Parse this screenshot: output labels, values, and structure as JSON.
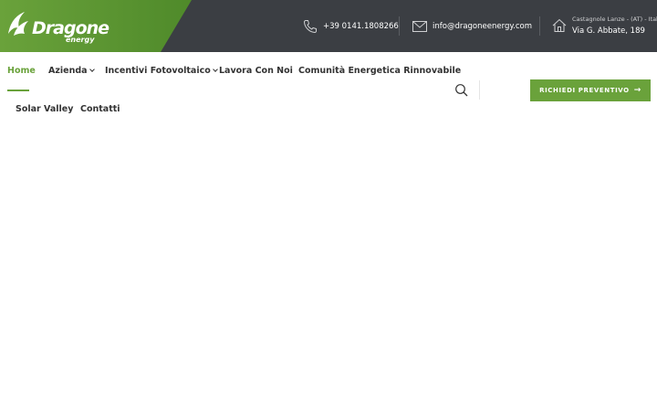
{
  "brand": {
    "name": "Dragone",
    "sub": "energy"
  },
  "topbar": {
    "phone": "+39 0141.1808266",
    "email": "info@dragoneenergy.com",
    "address_line1": "Castagnole Lanze - (AT) - Italy",
    "address_line2": "Via G. Abbate, 189"
  },
  "nav": {
    "home": "Home",
    "azienda": "Azienda",
    "incentivi": "Incentivi Fotovoltaico",
    "lavora": "Lavora Con Noi",
    "comunita": "Comunità Energetica Rinnovabile",
    "solar": "Solar Valley",
    "contatti": "Contatti"
  },
  "cta": {
    "label": "RICHIEDI PREVENTIVO",
    "arrow": "→"
  },
  "colors": {
    "accent": "#6aa23b",
    "topbar": "#3b3e43"
  },
  "icons": [
    "phone-icon",
    "mail-icon",
    "home-icon",
    "search-icon",
    "arrow-right-icon"
  ]
}
